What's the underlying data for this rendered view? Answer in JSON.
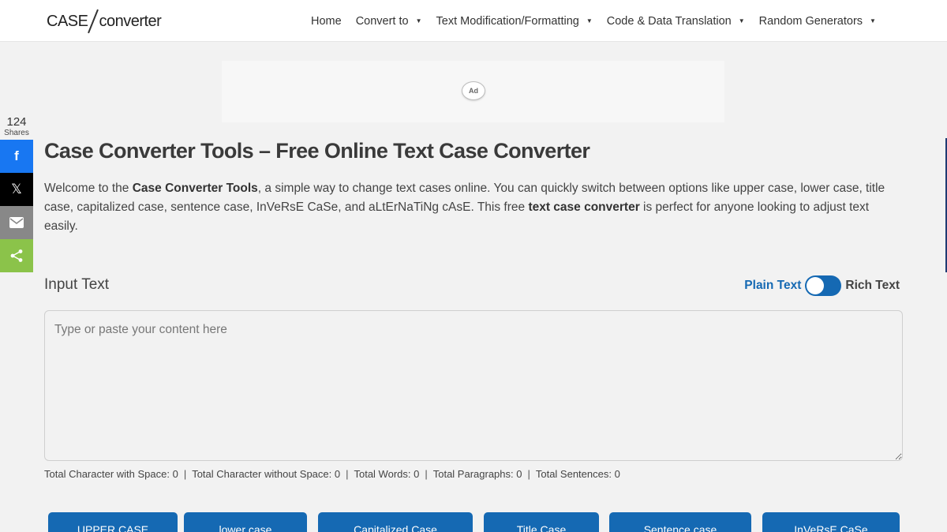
{
  "header": {
    "logo": {
      "part1": "CASE",
      "part2": "converter"
    },
    "nav": [
      {
        "label": "Home",
        "has_caret": false
      },
      {
        "label": "Convert to",
        "has_caret": true
      },
      {
        "label": "Text Modification/Formatting",
        "has_caret": true
      },
      {
        "label": "Code & Data Translation",
        "has_caret": true
      },
      {
        "label": "Random Generators",
        "has_caret": true
      }
    ],
    "caret": "▼"
  },
  "ad": {
    "badge": "Ad"
  },
  "share": {
    "count": "124",
    "count_label": "Shares",
    "buttons": [
      {
        "name": "facebook",
        "icon": "facebook-icon",
        "glyph": "f",
        "color": "#1877f2"
      },
      {
        "name": "x",
        "icon": "x-icon",
        "glyph": "𝕏",
        "color": "#000000"
      },
      {
        "name": "email",
        "icon": "email-icon",
        "color": "#888888"
      },
      {
        "name": "more",
        "icon": "share-icon",
        "color": "#8bc34a"
      }
    ]
  },
  "main": {
    "title": "Case Converter Tools – Free Online Text Case Converter",
    "intro": {
      "p1": "Welcome to the ",
      "b1": "Case Converter Tools",
      "p2": ", a simple way to change text cases online. You can quickly switch between options like upper case, lower case, title case, capitalized case, sentence case, InVeRsE CaSe, and aLtErNaTiNg cAsE. This free ",
      "b2": "text case converter",
      "p3": " is perfect for anyone looking to adjust text easily."
    },
    "input_label": "Input Text",
    "toggle": {
      "left": "Plain Text",
      "right": "Rich Text",
      "state": "Plain Text"
    },
    "textarea": {
      "value": "",
      "placeholder": "Type or paste your content here"
    },
    "stats": [
      "Total Character with Space: 0",
      "Total Character without Space: 0",
      "Total Words: 0",
      "Total Paragraphs: 0",
      "Total Sentences: 0"
    ],
    "stats_separator": "|",
    "buttons": [
      "UPPER CASE",
      "lower case",
      "Capitalized Case",
      "Title Case",
      "Sentence case",
      "InVeRsE CaSe"
    ]
  },
  "colors": {
    "accent": "#1569b3",
    "background": "#f2f2f2",
    "header": "#ffffff"
  }
}
